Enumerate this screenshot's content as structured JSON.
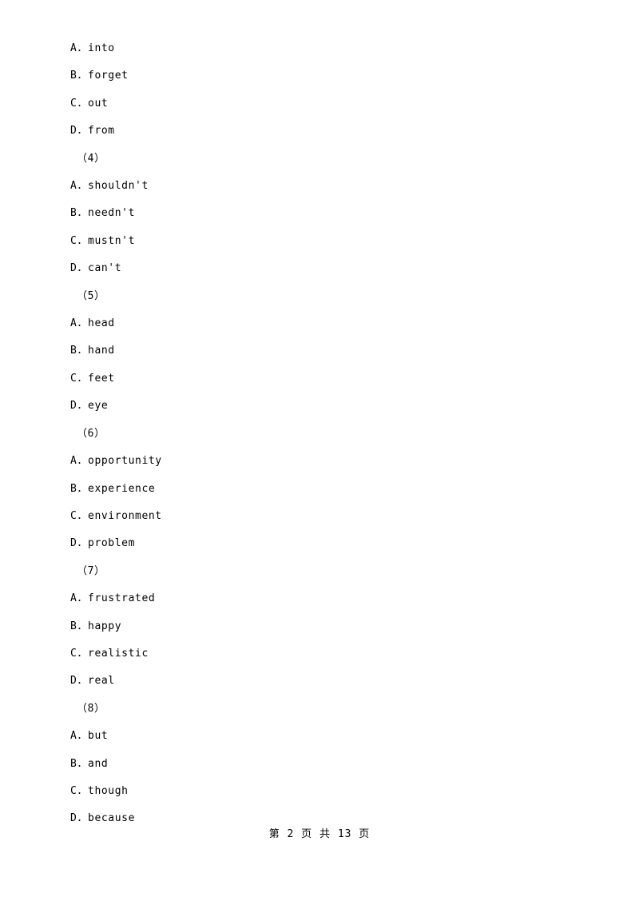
{
  "document": {
    "lines": [
      {
        "text": "A．into",
        "type": "option"
      },
      {
        "text": "B．forget",
        "type": "option"
      },
      {
        "text": "C．out",
        "type": "option"
      },
      {
        "text": "D．from",
        "type": "option"
      },
      {
        "text": "（4）",
        "type": "group"
      },
      {
        "text": "A．shouldn't",
        "type": "option"
      },
      {
        "text": "B．needn't",
        "type": "option"
      },
      {
        "text": "C．mustn't",
        "type": "option"
      },
      {
        "text": "D．can't",
        "type": "option"
      },
      {
        "text": "（5）",
        "type": "group"
      },
      {
        "text": "A．head",
        "type": "option"
      },
      {
        "text": "B．hand",
        "type": "option"
      },
      {
        "text": "C．feet",
        "type": "option"
      },
      {
        "text": "D．eye",
        "type": "option"
      },
      {
        "text": "（6）",
        "type": "group"
      },
      {
        "text": "A．opportunity",
        "type": "option"
      },
      {
        "text": "B．experience",
        "type": "option"
      },
      {
        "text": "C．environment",
        "type": "option"
      },
      {
        "text": "D．problem",
        "type": "option"
      },
      {
        "text": "（7）",
        "type": "group"
      },
      {
        "text": "A．frustrated",
        "type": "option"
      },
      {
        "text": "B．happy",
        "type": "option"
      },
      {
        "text": "C．realistic",
        "type": "option"
      },
      {
        "text": "D．real",
        "type": "option"
      },
      {
        "text": "（8）",
        "type": "group"
      },
      {
        "text": "A．but",
        "type": "option"
      },
      {
        "text": "B．and",
        "type": "option"
      },
      {
        "text": "C．though",
        "type": "option"
      },
      {
        "text": "D．because",
        "type": "option"
      }
    ],
    "footer": "第 2 页 共 13 页"
  }
}
